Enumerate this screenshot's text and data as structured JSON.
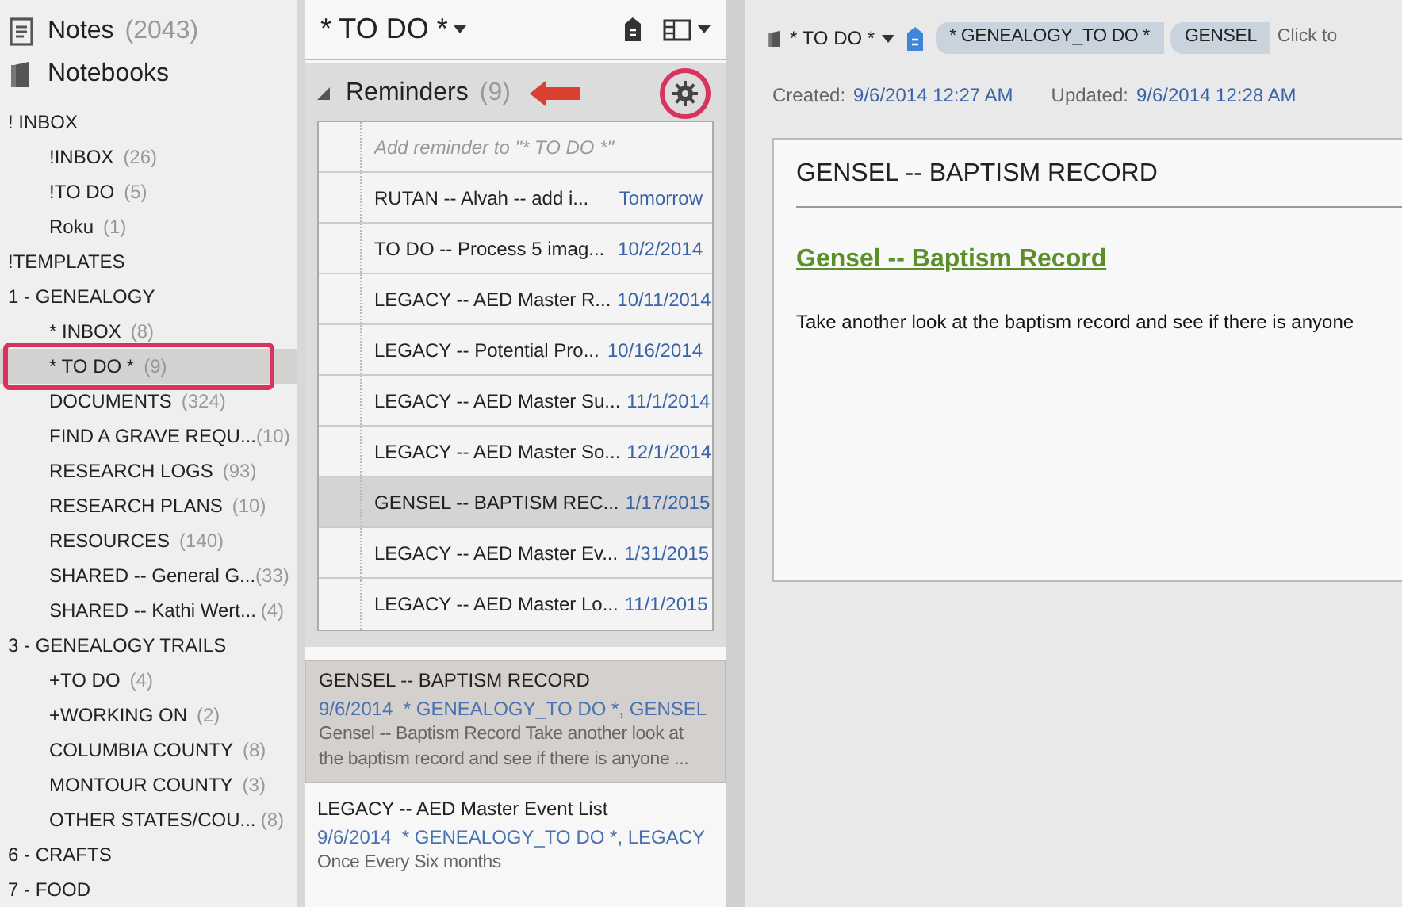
{
  "sidebar": {
    "header_items": [
      {
        "kind": "notes",
        "label": "Notes",
        "count": "(2043)"
      },
      {
        "kind": "notebooks",
        "label": "Notebooks"
      }
    ],
    "stacks": [
      {
        "label": "! INBOX",
        "children": [
          {
            "label": "!INBOX",
            "count": "(26)",
            "selected": false
          },
          {
            "label": "!TO DO",
            "count": "(5)",
            "selected": false
          },
          {
            "label": "Roku",
            "count": "(1)",
            "selected": false
          }
        ]
      },
      {
        "label": "!TEMPLATES"
      },
      {
        "label": "1 - GENEALOGY",
        "children": [
          {
            "label": "* INBOX",
            "count": "(8)",
            "selected": false
          },
          {
            "label": "* TO DO *",
            "count": "(9)",
            "selected": true
          },
          {
            "label": "DOCUMENTS",
            "count": "(324)",
            "selected": false
          },
          {
            "label": "FIND A GRAVE REQU...",
            "count": "(10)",
            "selected": false
          },
          {
            "label": "RESEARCH LOGS",
            "count": "(93)",
            "selected": false
          },
          {
            "label": "RESEARCH PLANS",
            "count": "(10)",
            "selected": false
          },
          {
            "label": "RESOURCES",
            "count": "(140)",
            "selected": false
          },
          {
            "label": "SHARED -- General G...",
            "count": "(33)",
            "selected": false
          },
          {
            "label": "SHARED -- Kathi Wert...",
            "count": "(4)",
            "selected": false
          }
        ]
      },
      {
        "label": "3 - GENEALOGY TRAILS",
        "children": [
          {
            "label": "+TO DO",
            "count": "(4)",
            "selected": false
          },
          {
            "label": "+WORKING ON",
            "count": "(2)",
            "selected": false
          },
          {
            "label": "COLUMBIA COUNTY",
            "count": "(8)",
            "selected": false
          },
          {
            "label": "MONTOUR COUNTY",
            "count": "(3)",
            "selected": false
          },
          {
            "label": "OTHER STATES/COU...",
            "count": "(8)",
            "selected": false
          }
        ]
      },
      {
        "label": "6 - CRAFTS"
      },
      {
        "label": "7 - FOOD"
      }
    ]
  },
  "note_list": {
    "title": "* TO DO *",
    "reminders": {
      "label": "Reminders",
      "count": "(9)",
      "expanded": true,
      "placeholder": "Add reminder to \"* TO DO *\"",
      "items": [
        {
          "title": "RUTAN -- Alvah -- add i...",
          "date": "Tomorrow",
          "selected": false
        },
        {
          "title": "TO DO -- Process 5 imag...",
          "date": "10/2/2014",
          "selected": false
        },
        {
          "title": "LEGACY -- AED Master R...",
          "date": "10/11/2014",
          "selected": false
        },
        {
          "title": "LEGACY -- Potential Pro...",
          "date": "10/16/2014",
          "selected": false
        },
        {
          "title": "LEGACY -- AED Master Su...",
          "date": "11/1/2014",
          "selected": false
        },
        {
          "title": "LEGACY -- AED Master So...",
          "date": "12/1/2014",
          "selected": false
        },
        {
          "title": "GENSEL -- BAPTISM REC...",
          "date": "1/17/2015",
          "selected": true
        },
        {
          "title": "LEGACY -- AED Master Ev...",
          "date": "1/31/2015",
          "selected": false
        },
        {
          "title": "LEGACY -- AED Master Lo...",
          "date": "11/1/2015",
          "selected": false
        }
      ]
    },
    "notes": [
      {
        "title": "GENSEL -- BAPTISM RECORD",
        "meta": "9/6/2014  * GENEALOGY_TO DO *, GENSEL",
        "snippet": "Gensel -- Baptism Record Take another look at the baptism record and see if there is anyone ...",
        "selected": true
      },
      {
        "title": "LEGACY -- AED Master Event List",
        "meta": "9/6/2014  * GENEALOGY_TO DO *, LEGACY",
        "snippet": "Once Every Six months",
        "selected": false
      }
    ]
  },
  "note": {
    "notebook": "* TO DO *",
    "tags": [
      "* GENEALOGY_TO DO *",
      "GENSEL"
    ],
    "tag_hint": "Click to",
    "created_label": "Created:",
    "created": "9/6/2014 12:27 AM",
    "updated_label": "Updated:",
    "updated": "9/6/2014 12:28 AM",
    "title": "GENSEL -- BAPTISM RECORD",
    "link": "Gensel -- Baptism Record",
    "body": "Take another look at the baptism record and see if there is anyone"
  }
}
